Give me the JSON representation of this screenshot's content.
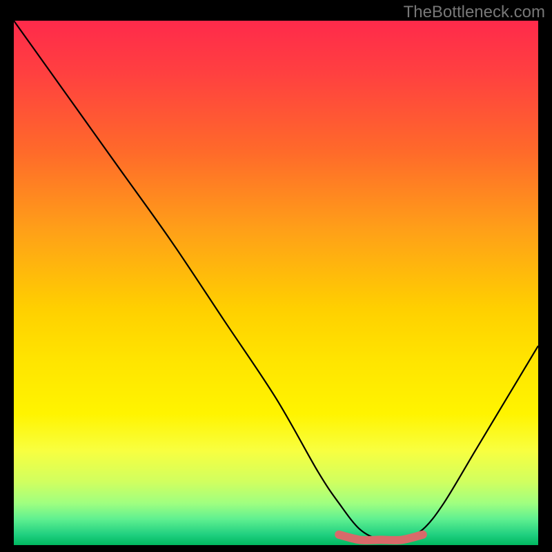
{
  "watermark": "TheBottleneck.com",
  "chart_data": {
    "type": "line",
    "title": "",
    "xlabel": "",
    "ylabel": "",
    "xlim": [
      0,
      100
    ],
    "ylim": [
      0,
      100
    ],
    "series": [
      {
        "name": "curve",
        "x": [
          0,
          10,
          20,
          30,
          40,
          50,
          58,
          62,
          66,
          70,
          74,
          78,
          82,
          88,
          94,
          100
        ],
        "y": [
          100,
          86,
          72,
          58,
          43,
          28,
          14,
          8,
          3,
          1,
          1,
          3,
          8,
          18,
          28,
          38
        ]
      }
    ],
    "highlight_segment": {
      "name": "bottleneck-zone",
      "x": [
        62,
        66,
        70,
        74,
        78
      ],
      "y": [
        2,
        1,
        1,
        1,
        2
      ]
    },
    "background_gradient": {
      "top": "#ff2a4b",
      "mid": "#ffe500",
      "bottom": "#00b860"
    }
  }
}
